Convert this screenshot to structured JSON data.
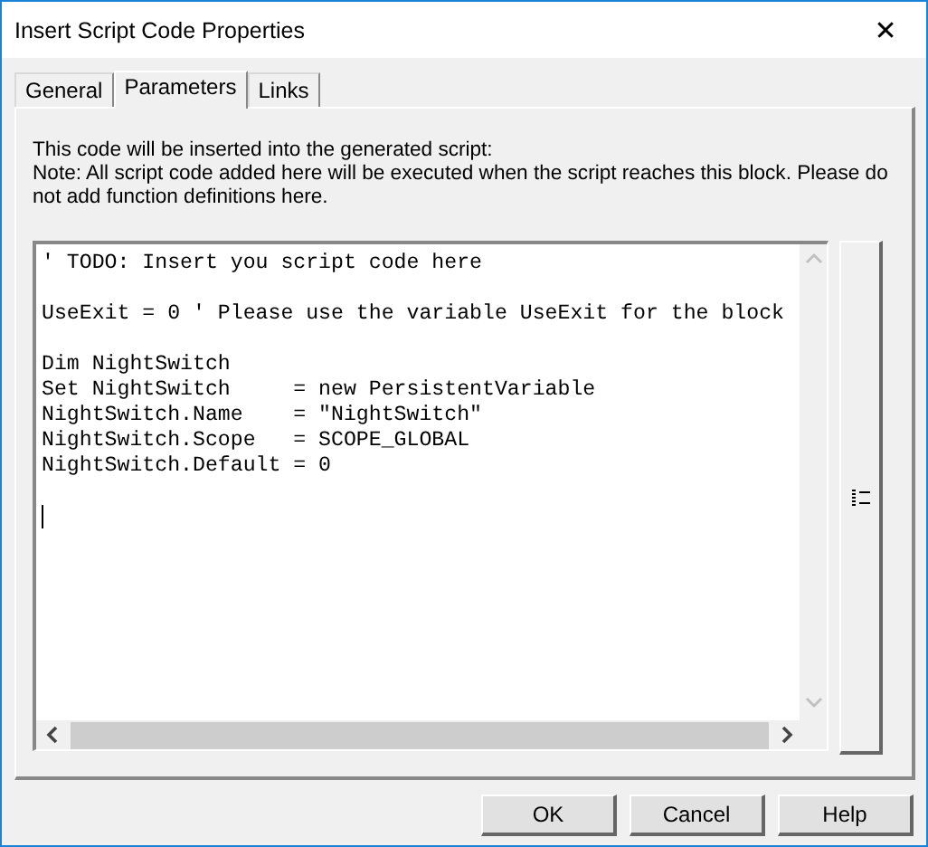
{
  "window": {
    "title": "Insert Script Code Properties",
    "close": "✕"
  },
  "tabs": [
    {
      "label": "General",
      "selected": false
    },
    {
      "label": "Parameters",
      "selected": true
    },
    {
      "label": "Links",
      "selected": false
    }
  ],
  "description": "This code will be inserted into the generated script:\nNote: All script code added here will be executed when the script reaches this block. Please do not add function definitions here.",
  "code_blocks": [
    [
      "' TODO: Insert you script code here"
    ],
    [
      "UseExit = 0 ' Please use the variable UseExit for the block"
    ],
    [
      "Dim NightSwitch",
      "Set NightSwitch     = new PersistentVariable",
      "NightSwitch.Name    = \"NightSwitch\"",
      "NightSwitch.Scope   = SCOPE_GLOBAL",
      "NightSwitch.Default = 0"
    ]
  ],
  "buttons": [
    "OK",
    "Cancel",
    "Help"
  ]
}
